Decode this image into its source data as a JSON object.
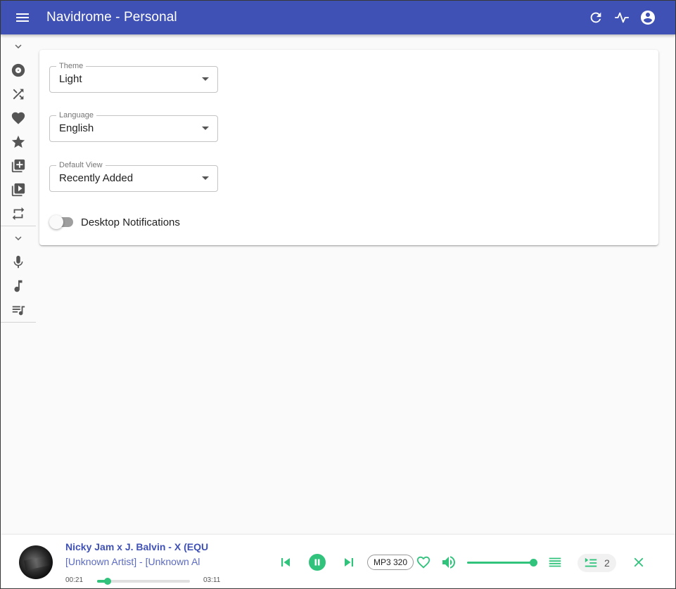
{
  "appbar": {
    "title": "Navidrome - Personal",
    "icons": [
      "menu-icon",
      "refresh-icon",
      "activity-icon",
      "account-icon"
    ],
    "color": "#3f51b5"
  },
  "sidebar": {
    "groups": [
      {
        "toggle_icon": "chevron-down-icon",
        "items": [
          "album-icon",
          "shuffle-icon",
          "heart-icon",
          "star-icon",
          "library-add-icon",
          "video-library-icon",
          "repeat-icon"
        ]
      },
      {
        "toggle_icon": "chevron-down-icon",
        "items": [
          "microphone-icon",
          "music-note-icon",
          "playlist-icon"
        ]
      }
    ]
  },
  "settings": {
    "theme": {
      "label": "Theme",
      "value": "Light"
    },
    "language": {
      "label": "Language",
      "value": "English"
    },
    "default_view": {
      "label": "Default View",
      "value": "Recently Added"
    },
    "notifications": {
      "label": "Desktop Notifications",
      "enabled": false
    }
  },
  "player": {
    "title": "Nicky Jam x J. Balvin - X (EQU",
    "artist": "[Unknown Artist] - [Unknown Al",
    "current_time": "00:21",
    "duration": "03:11",
    "progress": 0.11,
    "quality": "MP3 320",
    "volume": 1.0,
    "queue_count": "2",
    "accent": "#31c27c"
  }
}
